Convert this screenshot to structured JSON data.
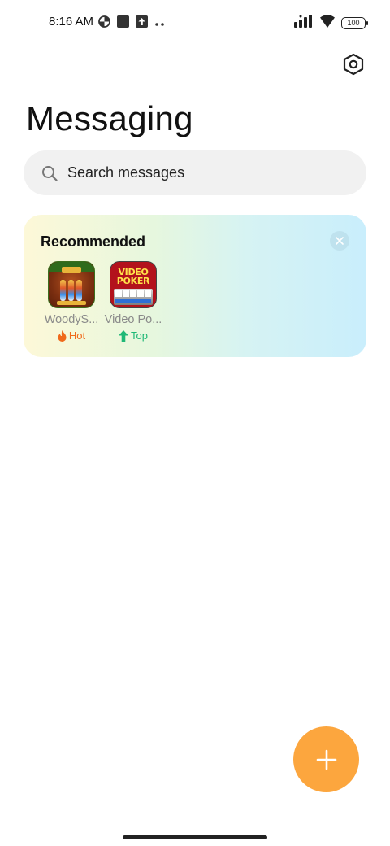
{
  "status_bar": {
    "time": "8:16 AM",
    "battery_level": "100",
    "icons_left": [
      "data-saver-icon",
      "square-notification-icon",
      "upload-notification-icon",
      "more-dots-icon"
    ],
    "icons_right": [
      "signal-bars-icon",
      "wifi-icon",
      "battery-icon"
    ]
  },
  "header": {
    "title": "Messaging",
    "settings_icon": "settings-hexagon-icon"
  },
  "search": {
    "placeholder": "Search messages",
    "icon": "search-icon"
  },
  "recommended": {
    "title": "Recommended",
    "close_icon": "close-icon",
    "apps": [
      {
        "name": "WoodyS...",
        "badge": "Hot",
        "badge_icon": "flame-icon",
        "badge_color": "#f06a1c"
      },
      {
        "name": "Video Po...",
        "badge": "Top",
        "badge_icon": "arrow-up-icon",
        "badge_color": "#1fb876",
        "icon_text_line1": "VIDEO",
        "icon_text_line2": "POKER"
      }
    ],
    "gradient_colors": [
      "#fdf8d8",
      "#e6f7de",
      "#d6f3f3",
      "#c9eefc"
    ]
  },
  "fab": {
    "icon": "plus-icon",
    "color": "#fca63e"
  },
  "colors": {
    "search_bg": "#f1f1f1",
    "hot": "#f06a1c",
    "top": "#1fb876"
  }
}
